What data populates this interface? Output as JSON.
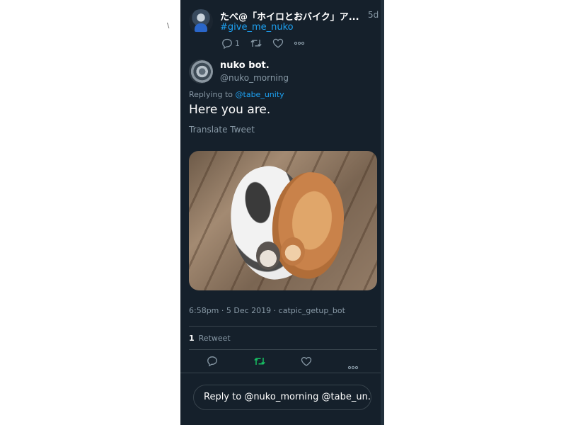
{
  "stray_mark": "\\",
  "parent_tweet": {
    "author": "たべ@「ホイロとおバイク」ア...",
    "time": "5d",
    "hashtag": "#give_me_nuko",
    "reply_count": "1"
  },
  "tweet": {
    "name": "nuko bot.",
    "handle": "@nuko_morning",
    "replying_prefix": "Replying to ",
    "replying_to": "@tabe_unity",
    "text": "Here you are.",
    "translate": "Translate Tweet",
    "meta": "6:58pm · 5 Dec 2019 · catpic_getup_bot",
    "retweet_count": "1",
    "retweet_label": "Retweet"
  },
  "reply_box": {
    "text": "Reply to @nuko_morning @tabe_un..."
  },
  "colors": {
    "background": "#15202b",
    "link": "#1da1f2",
    "muted": "#8899a6",
    "retweet_active": "#17bf63"
  }
}
